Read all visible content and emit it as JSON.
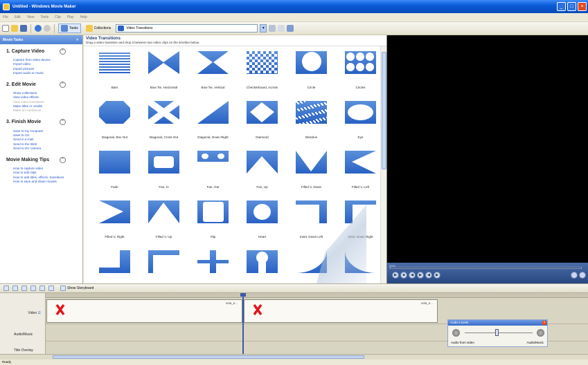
{
  "window": {
    "title": "Untitled - Windows Movie Maker"
  },
  "menu": [
    "File",
    "Edit",
    "View",
    "Tools",
    "Clip",
    "Play",
    "Help"
  ],
  "toolbar": {
    "tasks_label": "Tasks",
    "collections_label": "Collections",
    "location_value": "Video Transitions"
  },
  "tasks": {
    "header": "Movie Tasks",
    "close_glyph": "×",
    "sections": [
      {
        "title": "1. Capture Video",
        "items": [
          {
            "label": "Capture from video device",
            "enabled": true
          },
          {
            "label": "Import video",
            "enabled": true
          },
          {
            "label": "Import pictures",
            "enabled": true
          },
          {
            "label": "Import audio or music",
            "enabled": true
          }
        ]
      },
      {
        "title": "2. Edit Movie",
        "items": [
          {
            "label": "Show collections",
            "enabled": true
          },
          {
            "label": "View video effects",
            "enabled": true
          },
          {
            "label": "View video transitions",
            "enabled": false
          },
          {
            "label": "Make titles or credits",
            "enabled": true
          },
          {
            "label": "Make an AutoMovie",
            "enabled": false
          }
        ]
      },
      {
        "title": "3. Finish Movie",
        "items": [
          {
            "label": "Save to my computer",
            "enabled": true
          },
          {
            "label": "Save to CD",
            "enabled": true
          },
          {
            "label": "Send in e-mail",
            "enabled": true
          },
          {
            "label": "Send to the Web",
            "enabled": true
          },
          {
            "label": "Send to DV camera",
            "enabled": true
          }
        ]
      },
      {
        "title": "Movie Making Tips",
        "items": [
          {
            "label": "How to capture video",
            "enabled": true
          },
          {
            "label": "How to edit clips",
            "enabled": true
          },
          {
            "label": "How to add titles, effects, transitions",
            "enabled": true
          },
          {
            "label": "How to save and share movies",
            "enabled": true
          }
        ]
      }
    ]
  },
  "content": {
    "title": "Video Transitions",
    "subtitle": "Drag a video transition and drop it between two video clips on the timeline below.",
    "transitions": [
      "Bars",
      "Bow Tie, Horizontal",
      "Bow Tie, Vertical",
      "Checkerboard, Across",
      "Circle",
      "Circles",
      "Diagonal, Box Out",
      "Diagonal, Cross Out",
      "Diagonal, Down Right",
      "Diamond",
      "Dissolve",
      "Eye",
      "Fade",
      "Fan, In",
      "Fan, Out",
      "Fan, Up",
      "Filled V, Down",
      "Filled V, Left",
      "Filled V, Right",
      "Filled V, Up",
      "Flip",
      "Heart",
      "Inset, Down Left",
      "Inset, Down Right",
      "",
      "",
      "",
      "",
      "",
      ""
    ]
  },
  "preview": {
    "buttons": [
      "▶",
      "■",
      "◀",
      "▶",
      "◀",
      "▶"
    ]
  },
  "timeline": {
    "storyboard_label": "Show Storyboard",
    "tracks": {
      "video": "Video",
      "audio_music": "Audio/Music",
      "title_overlay": "Title Overlay"
    },
    "clips": [
      {
        "name": "vota_e..."
      },
      {
        "name": "vota_e..."
      }
    ]
  },
  "audio_levels": {
    "title": "Audio Levels",
    "left_label": "Audio from video",
    "right_label": "Audio/Music"
  },
  "status": {
    "text": "Ready"
  },
  "colors": {
    "accent": "#2a62c4",
    "title_bar": "#0a5bd8",
    "missing_clip": "#e5131a"
  }
}
